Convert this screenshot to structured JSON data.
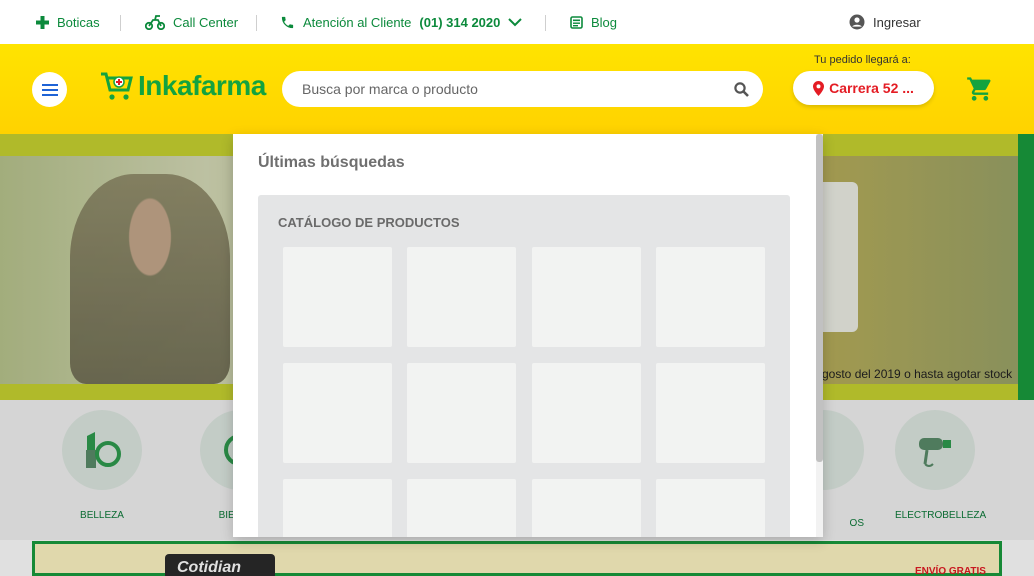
{
  "topbar": {
    "boticas": "Boticas",
    "call_center": "Call Center",
    "atencion_label": "Atención al Cliente",
    "atencion_phone": "(01) 314 2020",
    "blog": "Blog",
    "login": "Ingresar"
  },
  "header": {
    "brand": "Inkafarma",
    "search_placeholder": "Busca por marca o producto",
    "deliver_label": "Tu pedido llegará a:",
    "deliver_address": "Carrera 52 ..."
  },
  "hero": {
    "note": "gosto del 2019 o hasta agotar stock"
  },
  "categories": [
    {
      "label": "BELLEZA",
      "icon": "lipstick-icon"
    },
    {
      "label": "BIENEST",
      "icon": "wellness-icon"
    },
    {
      "label": "OS",
      "icon": "category-icon"
    },
    {
      "label": "ELECTROBELLEZA",
      "icon": "hair-dryer-icon"
    }
  ],
  "promo": {
    "brand": "Cotidian",
    "free_shipping": "ENVÍO GRATIS"
  },
  "dropdown": {
    "recent_title": "Últimas búsquedas",
    "catalog_title": "CATÁLOGO DE PRODUCTOS"
  },
  "colors": {
    "brand_green": "#13a33f",
    "header_yellow": "#ffdc00",
    "accent_red": "#e41c24"
  }
}
